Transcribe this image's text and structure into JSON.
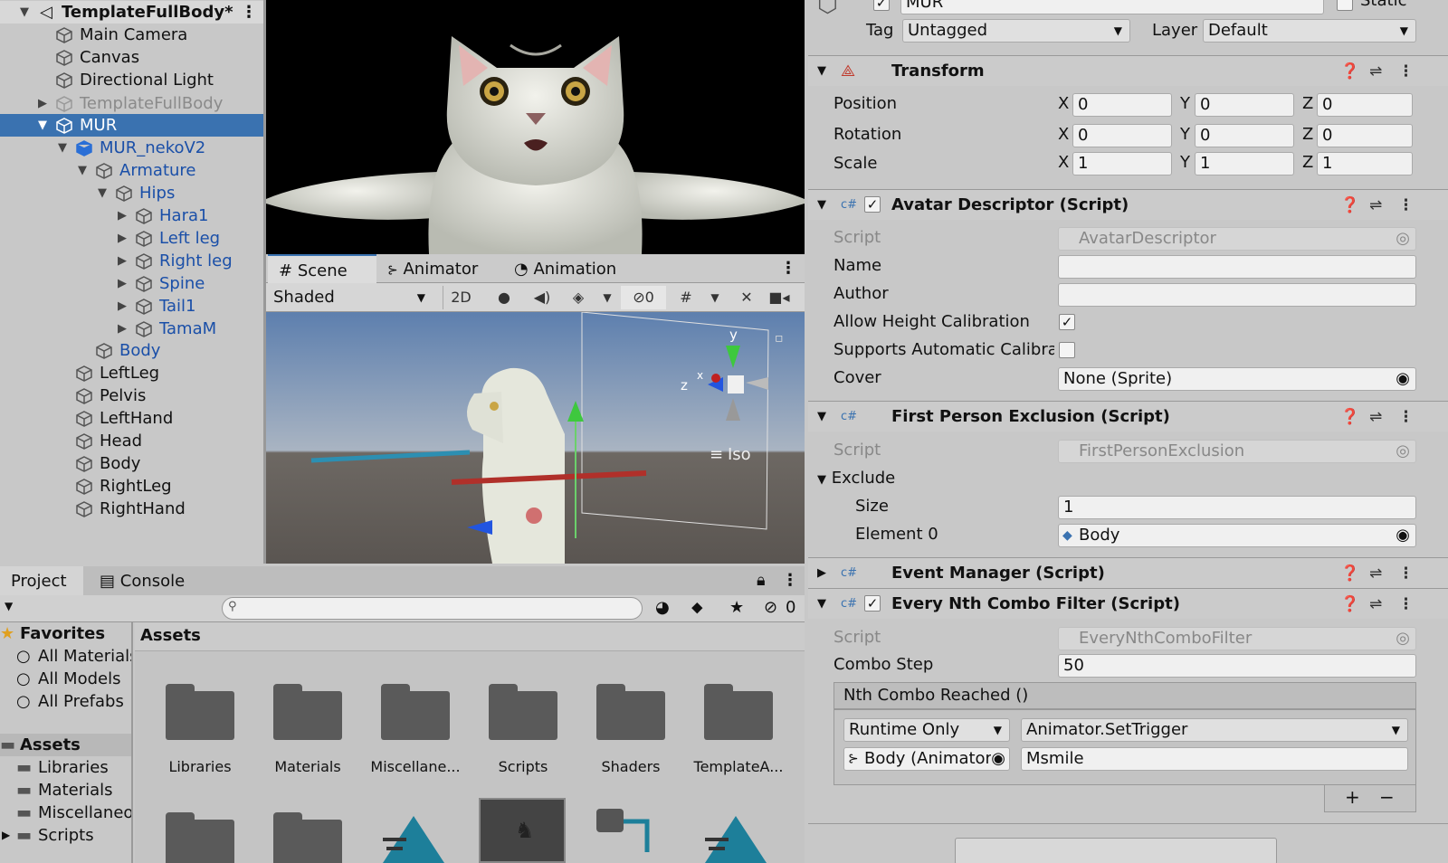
{
  "hierarchy": {
    "scene_name": "TemplateFullBody*",
    "items": [
      {
        "label": "Main Camera"
      },
      {
        "label": "Canvas"
      },
      {
        "label": "Directional Light"
      },
      {
        "label": "TemplateFullBody"
      },
      {
        "label": "MUR"
      },
      {
        "label": "MUR_nekoV2"
      },
      {
        "label": "Armature"
      },
      {
        "label": "Hips"
      },
      {
        "label": "Hara1"
      },
      {
        "label": "Left leg"
      },
      {
        "label": "Right leg"
      },
      {
        "label": "Spine"
      },
      {
        "label": "Tail1"
      },
      {
        "label": "TamaM"
      },
      {
        "label": "Body"
      },
      {
        "label": "LeftLeg"
      },
      {
        "label": "Pelvis"
      },
      {
        "label": "LeftHand"
      },
      {
        "label": "Head"
      },
      {
        "label": "Body"
      },
      {
        "label": "RightLeg"
      },
      {
        "label": "RightHand"
      }
    ]
  },
  "scene": {
    "tabs": [
      {
        "label": "Scene",
        "icon": "hash-icon"
      },
      {
        "label": "Animator",
        "icon": "animator-icon"
      },
      {
        "label": "Animation",
        "icon": "clock-icon"
      }
    ],
    "shading_mode": "Shaded",
    "mode_2d": "2D",
    "hidden_count": "0",
    "gizmo_y": "y",
    "gizmo_z": "z",
    "gizmo_x": "x",
    "view_mode": "Iso"
  },
  "project": {
    "tabs": [
      {
        "label": "Project"
      },
      {
        "label": "Console"
      }
    ],
    "hidden_count": "0",
    "search_placeholder": "",
    "favorites": {
      "header": "Favorites",
      "items": [
        "All Materials",
        "All Models",
        "All Prefabs"
      ]
    },
    "tree": {
      "header": "Assets",
      "items": [
        "Libraries",
        "Materials",
        "Miscellaneous",
        "Scripts"
      ]
    },
    "breadcrumb": "Assets",
    "folders": [
      "Libraries",
      "Materials",
      "Miscellane...",
      "Scripts",
      "Shaders",
      "TemplateA..."
    ]
  },
  "inspector": {
    "object_name": "MUR",
    "static_label": "Static",
    "tag_label": "Tag",
    "tag_value": "Untagged",
    "layer_label": "Layer",
    "layer_value": "Default",
    "transform": {
      "title": "Transform",
      "position_label": "Position",
      "rotation_label": "Rotation",
      "scale_label": "Scale",
      "axis_x": "X",
      "axis_y": "Y",
      "axis_z": "Z",
      "position": [
        "0",
        "0",
        "0"
      ],
      "rotation": [
        "0",
        "0",
        "0"
      ],
      "scale": [
        "1",
        "1",
        "1"
      ]
    },
    "avatar_descriptor": {
      "title": "Avatar Descriptor (Script)",
      "script_label": "Script",
      "script_value": "AvatarDescriptor",
      "name_label": "Name",
      "name_value": "",
      "author_label": "Author",
      "author_value": "",
      "allow_height_label": "Allow Height Calibration",
      "allow_height_checked": "✓",
      "supports_auto_label": "Supports Automatic Calibrat",
      "cover_label": "Cover",
      "cover_value": "None (Sprite)"
    },
    "first_person_exclusion": {
      "title": "First Person Exclusion (Script)",
      "script_label": "Script",
      "script_value": "FirstPersonExclusion",
      "exclude_label": "Exclude",
      "size_label": "Size",
      "size_value": "1",
      "element0_label": "Element 0",
      "element0_value": "Body"
    },
    "event_manager": {
      "title": "Event Manager (Script)"
    },
    "every_nth": {
      "title": "Every Nth Combo Filter (Script)",
      "script_label": "Script",
      "script_value": "EveryNthComboFilter",
      "combo_step_label": "Combo Step",
      "combo_step_value": "50",
      "event_header": "Nth Combo Reached ()",
      "runtime_value": "Runtime Only",
      "function_value": "Animator.SetTrigger",
      "target_value": "Body (Animator",
      "argument_value": "Msmile",
      "plus_label": "+",
      "minus_label": "−"
    }
  }
}
